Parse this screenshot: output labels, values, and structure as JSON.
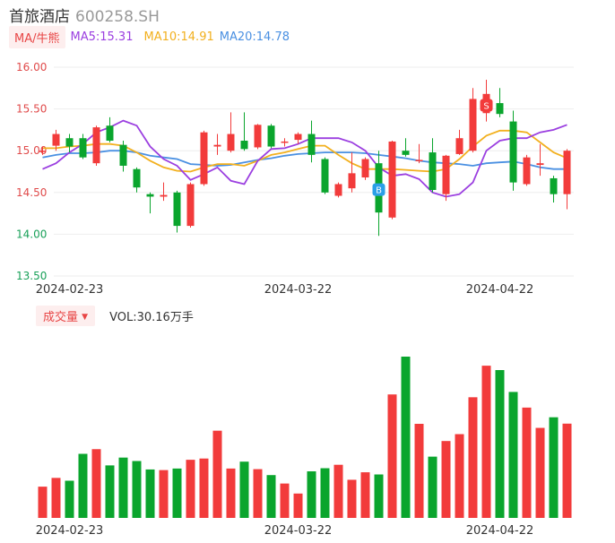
{
  "stock": {
    "name": "首旅酒店",
    "code": "600258.SH"
  },
  "ma_legend": {
    "tag": "MA/牛熊",
    "items": [
      {
        "label": "MA5:15.31",
        "color": "#9b3fe0"
      },
      {
        "label": "MA10:14.91",
        "color": "#f2b01e"
      },
      {
        "label": "MA20:14.78",
        "color": "#4a90e2"
      }
    ]
  },
  "volume_legend": {
    "tag": "成交量",
    "arrow": "▼",
    "text": "VOL:30.16万手"
  },
  "colors": {
    "up": "#f23b3b",
    "down": "#0aa52d",
    "ma5": "#9b3fe0",
    "ma10": "#f2b01e",
    "ma20": "#4a90e2",
    "axis_label": "#e04a4a",
    "axis_label_low": "#18a058"
  },
  "chart_data": {
    "type": "candlestick",
    "price_axis": {
      "ylim": [
        13.5,
        16.0
      ],
      "ticks": [
        "16.00",
        "15.50",
        "15.00",
        "14.50",
        "14.00",
        "13.50"
      ]
    },
    "x_ticks": [
      {
        "index": 2,
        "label": "2024-02-23"
      },
      {
        "index": 19,
        "label": "2024-03-22"
      },
      {
        "index": 34,
        "label": "2024-04-22"
      }
    ],
    "candles": [
      [
        15.0,
        15.0,
        15.05,
        14.95
      ],
      [
        15.06,
        15.2,
        15.25,
        15.0
      ],
      [
        15.15,
        15.05,
        15.2,
        14.98
      ],
      [
        15.15,
        14.92,
        15.2,
        14.9
      ],
      [
        14.85,
        15.28,
        15.3,
        14.82
      ],
      [
        15.3,
        15.12,
        15.4,
        15.1
      ],
      [
        15.07,
        14.82,
        15.12,
        14.75
      ],
      [
        14.78,
        14.56,
        14.8,
        14.5
      ],
      [
        14.48,
        14.45,
        14.5,
        14.25
      ],
      [
        14.45,
        14.47,
        14.62,
        14.4
      ],
      [
        14.5,
        14.1,
        14.52,
        14.02
      ],
      [
        14.1,
        14.6,
        14.62,
        14.08
      ],
      [
        14.6,
        15.22,
        15.24,
        14.58
      ],
      [
        15.05,
        15.07,
        15.2,
        14.95
      ],
      [
        15.0,
        15.2,
        15.46,
        14.98
      ],
      [
        15.12,
        15.02,
        15.46,
        15.0
      ],
      [
        15.04,
        15.31,
        15.32,
        15.02
      ],
      [
        15.3,
        15.05,
        15.32,
        15.03
      ],
      [
        15.1,
        15.11,
        15.15,
        15.05
      ],
      [
        15.13,
        15.2,
        15.22,
        15.08
      ],
      [
        15.2,
        14.95,
        15.36,
        14.86
      ],
      [
        14.9,
        14.5,
        14.92,
        14.48
      ],
      [
        14.46,
        14.6,
        14.62,
        14.44
      ],
      [
        14.55,
        14.73,
        14.98,
        14.5
      ],
      [
        14.68,
        14.9,
        14.92,
        14.65
      ],
      [
        14.85,
        14.26,
        15.0,
        13.98
      ],
      [
        14.2,
        15.11,
        15.12,
        14.18
      ],
      [
        15.0,
        14.95,
        15.15,
        14.93
      ],
      [
        14.88,
        14.89,
        15.08,
        14.85
      ],
      [
        14.98,
        14.53,
        15.15,
        14.5
      ],
      [
        14.48,
        14.94,
        14.95,
        14.4
      ],
      [
        14.96,
        15.15,
        15.25,
        14.95
      ],
      [
        15.0,
        15.62,
        15.75,
        14.98
      ],
      [
        15.45,
        15.68,
        15.85,
        15.35
      ],
      [
        15.57,
        15.44,
        15.75,
        15.4
      ],
      [
        15.35,
        14.62,
        15.48,
        14.52
      ],
      [
        14.6,
        14.92,
        14.95,
        14.58
      ],
      [
        14.83,
        14.85,
        15.08,
        14.7
      ],
      [
        14.67,
        14.48,
        14.7,
        14.38
      ],
      [
        14.48,
        15.0,
        15.02,
        14.3
      ]
    ],
    "ma5": [
      14.78,
      14.85,
      14.98,
      15.08,
      15.22,
      15.28,
      15.36,
      15.3,
      15.05,
      14.9,
      14.82,
      14.65,
      14.72,
      14.8,
      14.64,
      14.6,
      14.88,
      15.02,
      15.03,
      15.08,
      15.15,
      15.15,
      15.15,
      15.1,
      15.0,
      14.8,
      14.7,
      14.72,
      14.66,
      14.5,
      14.45,
      14.48,
      14.62,
      15.0,
      15.12,
      15.15,
      15.15,
      15.22,
      15.25,
      15.31
    ],
    "ma10": [
      15.03,
      15.03,
      15.05,
      15.06,
      15.08,
      15.08,
      15.06,
      14.98,
      14.88,
      14.8,
      14.76,
      14.75,
      14.8,
      14.84,
      14.84,
      14.82,
      14.88,
      14.95,
      14.98,
      15.02,
      15.06,
      15.06,
      14.95,
      14.85,
      14.78,
      14.78,
      14.78,
      14.77,
      14.76,
      14.75,
      14.78,
      14.9,
      15.05,
      15.18,
      15.24,
      15.24,
      15.22,
      15.1,
      14.98,
      14.91
    ],
    "ma20": [
      14.92,
      14.95,
      14.97,
      14.97,
      14.98,
      15.0,
      15.0,
      14.98,
      14.94,
      14.92,
      14.9,
      14.84,
      14.83,
      14.82,
      14.83,
      14.86,
      14.89,
      14.91,
      14.94,
      14.96,
      14.97,
      14.98,
      14.98,
      14.98,
      14.97,
      14.95,
      14.93,
      14.91,
      14.88,
      14.86,
      14.85,
      14.84,
      14.82,
      14.85,
      14.86,
      14.87,
      14.84,
      14.8,
      14.78,
      14.78
    ],
    "volume": {
      "unit": "万手",
      "values": [
        10.0,
        12.8,
        11.9,
        20.5,
        22.0,
        16.8,
        19.3,
        18.2,
        15.5,
        15.3,
        15.8,
        18.6,
        19.0,
        27.9,
        15.8,
        18.0,
        15.6,
        13.7,
        11.0,
        7.8,
        14.9,
        15.9,
        17.0,
        12.2,
        14.6,
        13.9,
        39.5,
        51.6,
        30.1,
        19.6,
        24.6,
        26.8,
        38.6,
        48.7,
        47.3,
        40.3,
        35.3,
        28.8,
        32.2,
        30.16
      ]
    },
    "markers": [
      {
        "index": 25,
        "label": "B",
        "color": "#2b9fe8"
      },
      {
        "index": 33,
        "label": "S",
        "color": "#f23b3b"
      }
    ]
  }
}
